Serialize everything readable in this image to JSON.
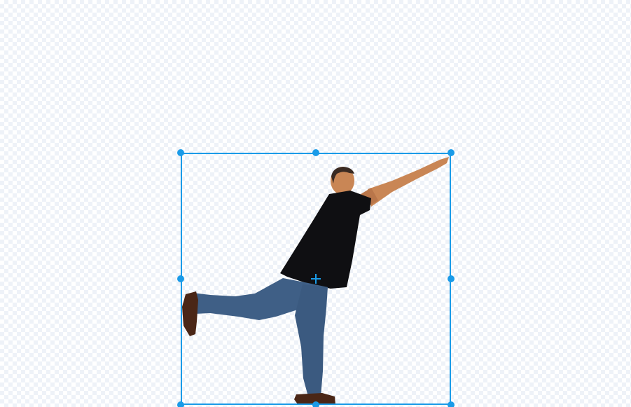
{
  "editor": {
    "selected_object": "person-sprite",
    "colors": {
      "selection": "#1a9be8",
      "checker_light": "#ffffff",
      "checker_dark": "#eef2f8",
      "shirt": "#0f0f12",
      "jeans": "#3f5f86",
      "skin": "#c98655",
      "shoes": "#4a2616"
    },
    "icons": {
      "center": "crosshair-icon"
    }
  }
}
